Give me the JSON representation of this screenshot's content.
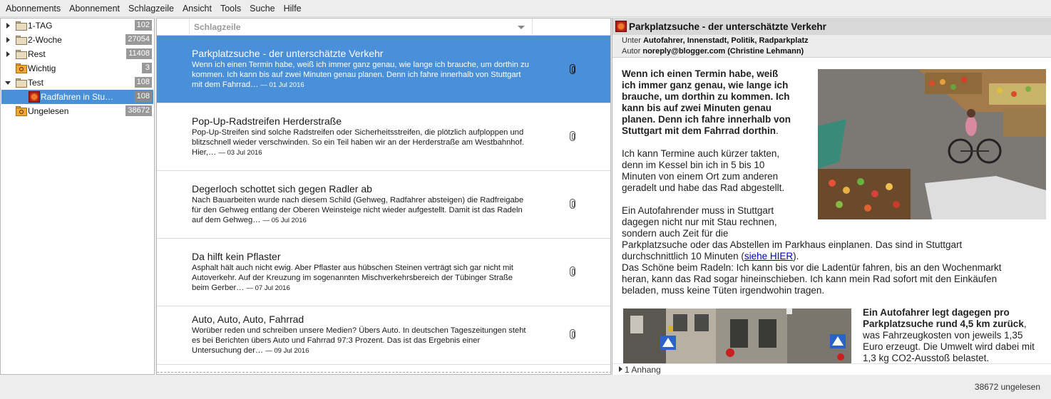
{
  "menu": [
    "Abonnements",
    "Abonnement",
    "Schlagzeile",
    "Ansicht",
    "Tools",
    "Suche",
    "Hilfe"
  ],
  "feeds": [
    {
      "label": "1-TAG",
      "count": "102"
    },
    {
      "label": "2-Woche",
      "count": "27054"
    },
    {
      "label": "Rest",
      "count": "11408"
    },
    {
      "label": "Wichtig",
      "count": "3"
    },
    {
      "label": "Test",
      "count": "108"
    },
    {
      "label": "Radfahren in Stu…",
      "count": "108"
    },
    {
      "label": "Ungelesen",
      "count": "38672"
    }
  ],
  "headlines": {
    "column_title": "Schlagzeile",
    "items": [
      {
        "title": "Parkplatzsuche - der unterschätzte Verkehr",
        "body": "Wenn ich einen Termin habe, weiß ich immer ganz genau, wie lange ich brauche, um dorthin zu kommen. Ich kann bis auf zwei Minuten genau planen. Denn ich fahre innerhalb von Stuttgart mit dem Fahrrad…",
        "date": "— 01 Jul 2016"
      },
      {
        "title": "Pop-Up-Radstreifen Herderstraße",
        "body": "Pop-Up-Streifen sind solche Radstreifen oder Sicherheitsstreifen, die plötzlich aufploppen und blitzschnell wieder verschwinden. So ein Teil haben wir an der Herderstraße am Westbahnhof. Hier,…",
        "date": "— 03 Jul 2016"
      },
      {
        "title": "Degerloch schottet sich gegen Radler ab",
        "body": "Nach Bauarbeiten wurde nach diesem Schild (Gehweg, Radfahrer absteigen) die Radfreigabe für den Gehweg entlang der Oberen Weinsteige nicht wieder aufgestellt. Damit ist das Radeln auf dem Gehweg…",
        "date": "— 05 Jul 2016"
      },
      {
        "title": "Da hilft kein Pflaster",
        "body": "Asphalt hält auch nicht ewig. Aber Pflaster aus hübschen Steinen verträgt sich gar nicht mit Autoverkehr. Auf der Kreuzung im sogenannten Mischverkehrsbereich der Tübinger Straße beim Gerber…",
        "date": "— 07 Jul 2016"
      },
      {
        "title": "Auto, Auto, Auto, Fahrrad",
        "body": "Worüber reden und schreiben unsere Medien? Übers Auto. In deutschen Tageszeitungen steht es bei Berichten übers Auto und Fahrrad 97:3 Prozent. Das ist das Ergebnis einer Untersuchung der…",
        "date": "— 09 Jul 2016"
      }
    ]
  },
  "article": {
    "title": "Parkplatzsuche - der unterschätzte Verkehr",
    "category_label": "Unter",
    "categories": "Autofahrer, Innenstadt, Politik, Radparkplatz",
    "author_label": "Autor",
    "author": "noreply@blogger.com (Christine Lehmann)",
    "p1_bold_lines": [
      "Wenn ich einen Termin habe, weiß",
      "ich immer ganz genau, wie lange ich",
      "brauche, um dorthin zu kommen. Ich",
      "kann bis auf zwei Minuten genau",
      "planen. Denn ich fahre innerhalb von",
      "Stuttgart mit dem Fahrrad dorthin"
    ],
    "p1_end": ".",
    "p2_lines": [
      "Ich kann Termine auch kürzer takten,",
      "denn im Kessel bin ich in 5 bis 10",
      "Minuten von einem Ort zum anderen",
      "geradelt und habe das Rad abgestellt."
    ],
    "p3_lines": [
      "Ein Autofahrender muss in Stuttgart",
      "dagegen nicht nur mit Stau rechnen,",
      "sondern auch Zeit für die",
      "Parkplatzsuche oder das Abstellen im Parkhaus einplanen. Das sind in Stuttgart"
    ],
    "p3_last_pre": "durchschnittlich 10 Minuten (",
    "p3_link": "siehe HIER",
    "p3_last_post": ").",
    "p4_lines": [
      "Das Schöne beim Radeln: Ich kann bis vor die Ladentür fahren, bis an den Wochenmarkt",
      "heran, kann das Rad sogar hineinschieben. Ich kann mein Rad sofort mit den Einkäufen",
      "beladen, muss keine Tüten irgendwohin tragen."
    ],
    "p5_bold_lines": [
      "Ein Autofahrer legt dagegen pro",
      "Parkplatzsuche rund 4,5 km zurück"
    ],
    "p5_bold_end": ",",
    "p5_lines": [
      "was Fahrzeugkosten von jeweils 1,35",
      "Euro erzeugt. Die Umwelt wird dabei mit",
      "1,3 kg CO2-Ausstoß belastet."
    ],
    "attachment": "1 Anhang"
  },
  "status": "38672 ungelesen"
}
